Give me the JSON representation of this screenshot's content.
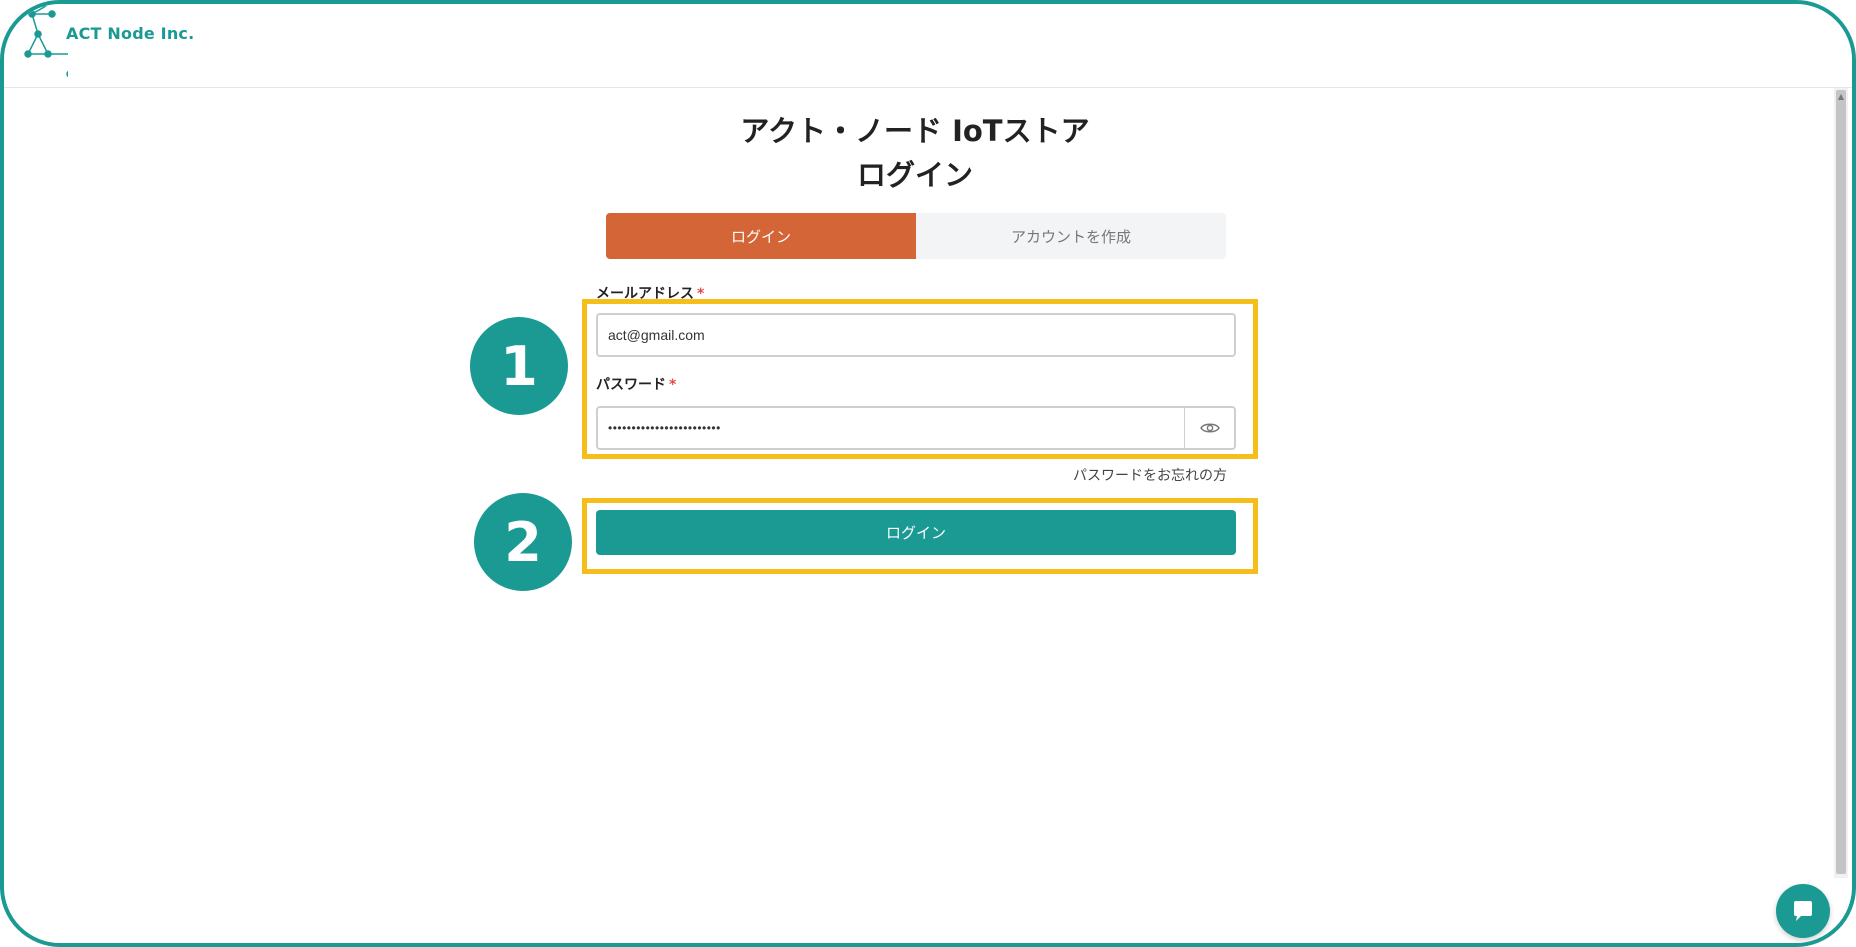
{
  "header": {
    "logo_text": "ACT Node Inc.",
    "logo_icon": "network-nodes-icon"
  },
  "page": {
    "title_line1": "アクト・ノード IoTストア",
    "title_line2": "ログイン"
  },
  "tabs": [
    {
      "label": "ログイン",
      "active": true
    },
    {
      "label": "アカウントを作成",
      "active": false
    }
  ],
  "form": {
    "email_label": "メールアドレス",
    "email_value": "act@gmail.com",
    "password_label": "パスワード",
    "password_value": "••••••••••••••••••••••••",
    "required_mark": "*",
    "forgot_link": "パスワードをお忘れの方",
    "submit_label": "ログイン",
    "toggle_icon": "eye-icon"
  },
  "annotations": {
    "marker1": "1",
    "marker2": "2",
    "highlight_color": "#f5be1a"
  },
  "colors": {
    "accent": "#1a9a93",
    "tab_active": "#d46537"
  },
  "chat": {
    "icon": "chat-bubble-icon"
  }
}
